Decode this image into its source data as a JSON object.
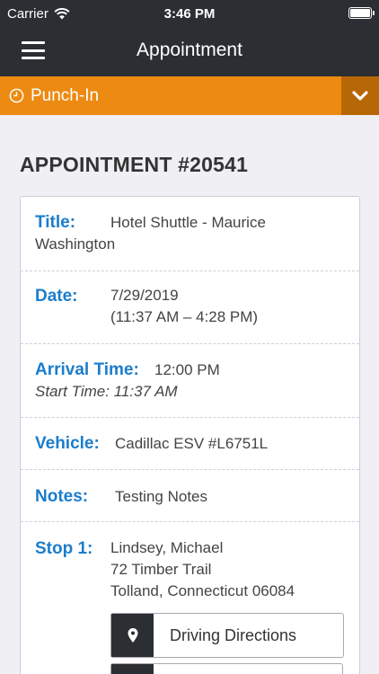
{
  "status": {
    "carrier": "Carrier",
    "time": "3:46 PM"
  },
  "nav": {
    "title": "Appointment",
    "menu_icon": "hamburger-icon"
  },
  "punch": {
    "label": "Punch-In",
    "icon": "clock-icon",
    "toggle_icon": "chevron-down-icon"
  },
  "appointment": {
    "heading": "APPOINTMENT #20541",
    "title_label": "Title:",
    "title_value_1": "Hotel Shuttle - Maurice",
    "title_value_2": "Washington",
    "date_label": "Date:",
    "date_value": "7/29/2019",
    "time_range": "(11:37 AM – 4:28 PM)",
    "arrival_label": "Arrival Time:",
    "arrival_value": "12:00 PM",
    "start_time": "Start Time: 11:37 AM",
    "vehicle_label": "Vehicle:",
    "vehicle_value": "Cadillac ESV #L6751L",
    "notes_label": "Notes:",
    "notes_value": "Testing Notes",
    "stop_label": "Stop 1:",
    "stop_name": "Lindsey, Michael",
    "stop_street": "72 Timber Trail",
    "stop_city": "Tolland, Connecticut 06084",
    "directions_label": "Driving Directions",
    "directions_icon": "map-pin-icon"
  }
}
